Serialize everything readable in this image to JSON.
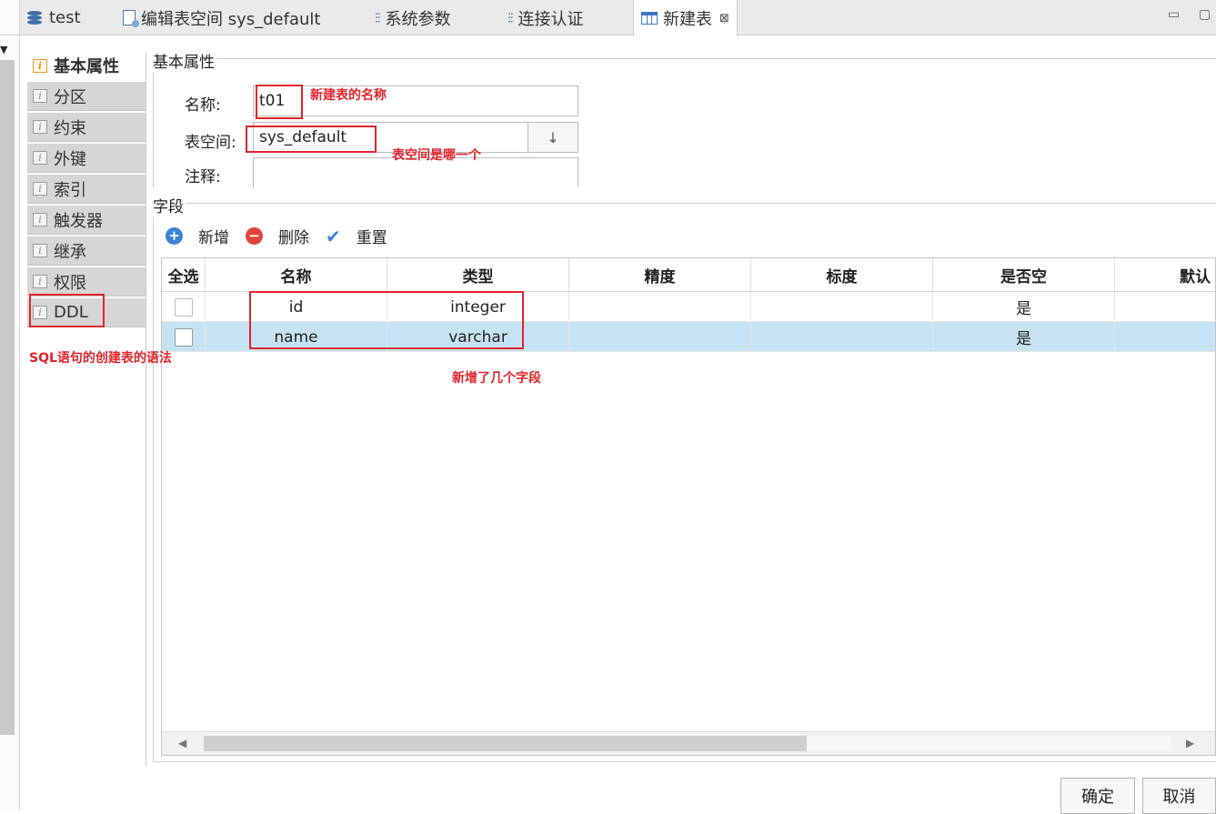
{
  "tabs": [
    {
      "label": "test",
      "icon": "database-icon"
    },
    {
      "label": "编辑表空间 sys_default",
      "icon": "document-icon"
    },
    {
      "label": "系统参数",
      "icon": "sliders-icon"
    },
    {
      "label": "连接认证",
      "icon": "sliders-icon"
    },
    {
      "label": "新建表",
      "icon": "table-icon",
      "active": true
    }
  ],
  "window": {
    "minimize": "▭",
    "maximize": "▢"
  },
  "nav": {
    "items": [
      {
        "label": "基本属性"
      },
      {
        "label": "分区"
      },
      {
        "label": "约束"
      },
      {
        "label": "外键"
      },
      {
        "label": "索引"
      },
      {
        "label": "触发器"
      },
      {
        "label": "继承"
      },
      {
        "label": "权限"
      },
      {
        "label": "DDL"
      }
    ]
  },
  "basic": {
    "group_title": "基本属性",
    "name_label": "名称:",
    "name_value": "t01",
    "tablespace_label": "表空间:",
    "tablespace_value": "sys_default",
    "comment_label": "注释:",
    "comment_value": ""
  },
  "fields": {
    "group_title": "字段",
    "toolbar": {
      "add": "新增",
      "delete": "删除",
      "reset": "重置"
    },
    "columns": [
      "全选",
      "名称",
      "类型",
      "精度",
      "标度",
      "是否空",
      "默认"
    ],
    "rows": [
      {
        "name": "id",
        "type": "integer",
        "precision": "",
        "scale": "",
        "nullable": "是"
      },
      {
        "name": "name",
        "type": "varchar",
        "precision": "",
        "scale": "",
        "nullable": "是"
      }
    ]
  },
  "annotations": {
    "name_note": "新建表的名称",
    "tablespace_note": "表空间是哪一个",
    "ddl_note": "SQL语句的创建表的语法",
    "fields_note": "新增了几个字段"
  },
  "buttons": {
    "ok": "确定",
    "cancel": "取消"
  },
  "colors": {
    "annotation": "#e0242c",
    "selected_row": "#c5e3f3",
    "add_icon": "#3b82d6",
    "delete_icon": "#e0443b"
  }
}
